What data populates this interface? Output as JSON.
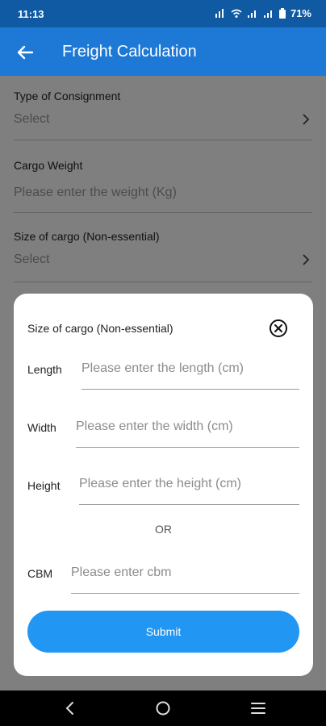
{
  "status_bar": {
    "time": "11:13",
    "battery": "71%"
  },
  "app_bar": {
    "title": "Freight Calculation",
    "back_icon": "back-arrow-icon"
  },
  "form": {
    "consignment": {
      "label": "Type of Consignment",
      "value": "Select"
    },
    "weight": {
      "label": "Cargo Weight",
      "placeholder": "Please enter the weight (Kg)"
    },
    "size": {
      "label": "Size of cargo (Non-essential)",
      "value": "Select"
    }
  },
  "modal": {
    "title": "Size of cargo (Non-essential)",
    "length": {
      "label": "Length",
      "placeholder": "Please enter the length (cm)"
    },
    "width": {
      "label": "Width",
      "placeholder": "Please enter the width (cm)"
    },
    "height": {
      "label": "Height",
      "placeholder": "Please enter the height (cm)"
    },
    "or_text": "OR",
    "cbm": {
      "label": "CBM",
      "placeholder": "Please enter cbm"
    },
    "submit_label": "Submit"
  },
  "colors": {
    "status_bar": "#0f5aa3",
    "app_bar": "#1e78d6",
    "submit": "#2196f3"
  }
}
